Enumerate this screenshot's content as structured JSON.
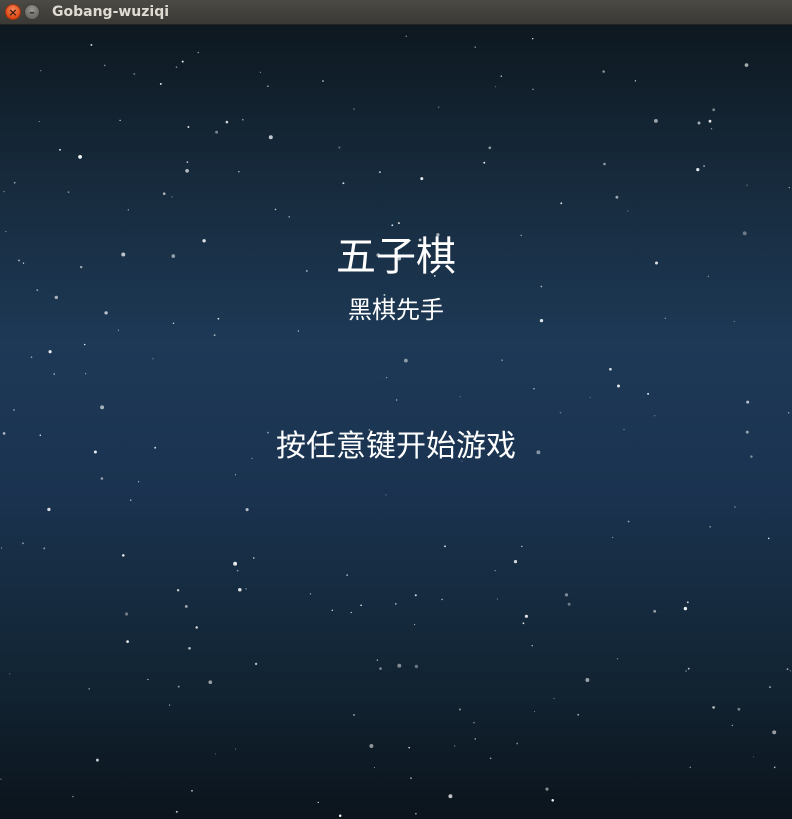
{
  "window": {
    "title": "Gobang-wuziqi",
    "close_glyph": "×",
    "minimize_glyph": "–"
  },
  "game": {
    "title": "五子棋",
    "subtitle": "黑棋先手",
    "prompt": "按任意键开始游戏"
  },
  "colors": {
    "title_text": "#dfdbd2",
    "close_button": "#dd4814",
    "overlay_text": "#ffffff"
  }
}
